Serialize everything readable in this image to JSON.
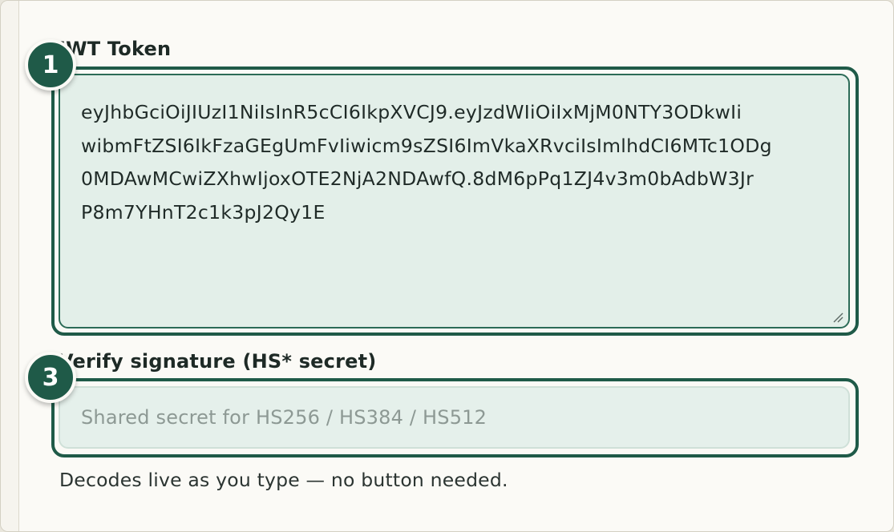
{
  "token_field": {
    "label": "JWT Token",
    "lines": [
      "eyJhbGciOiJIUzI1NiIsInR5cCI6IkpXVCJ9.eyJzdWIiOiIxMjM0NTY3ODkwIi",
      "wibmFtZSI6IkFzaGEgUmFvIiwicm9sZSI6ImVkaXRvciIsImlhdCI6MTc1ODg",
      "0MDAwMCwiZXhwIjoxOTE2NjA2NDAwfQ.8dM6pPq1ZJ4v3m0bAdbW3Jr",
      "P8m7YHnT2c1k3pJ2Qy1E"
    ],
    "badge": "1"
  },
  "secret_field": {
    "label": "Verify signature (HS* secret)",
    "placeholder": "Shared secret for HS256 / HS384 / HS512",
    "value": "",
    "badge": "3"
  },
  "hint": "Decodes live as you type — no button needed.",
  "colors": {
    "accent": "#1f5a48",
    "field_bg": "#e3efe9",
    "page_bg": "#fbfaf6"
  }
}
